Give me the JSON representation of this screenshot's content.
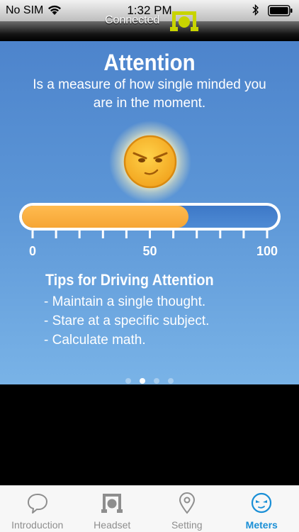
{
  "status_bar": {
    "carrier": "No SIM",
    "time": "1:32 PM"
  },
  "header": {
    "connection_status": "Connected",
    "accent_color": "#c8d400"
  },
  "meter": {
    "title": "Attention",
    "description": "Is a measure of how single minded you are in the moment.",
    "face_icon": "focused-face-icon",
    "value": 65,
    "scale_labels": [
      "0",
      "50",
      "100"
    ],
    "fill_color": "#f6a534",
    "tips_title": "Tips for Driving Attention",
    "tips": [
      "- Maintain a single thought.",
      "- Stare at a specific subject.",
      "- Calculate math."
    ]
  },
  "pager": {
    "page_count": 4,
    "current_page": 2
  },
  "tab_bar": {
    "tabs": [
      {
        "label": "Introduction",
        "icon": "speech-bubble-head-icon",
        "active": false
      },
      {
        "label": "Headset",
        "icon": "headset-icon",
        "active": false
      },
      {
        "label": "Setting",
        "icon": "location-pin-icon",
        "active": false
      },
      {
        "label": "Meters",
        "icon": "meters-face-icon",
        "active": true
      }
    ],
    "active_color": "#1a8fd6"
  }
}
